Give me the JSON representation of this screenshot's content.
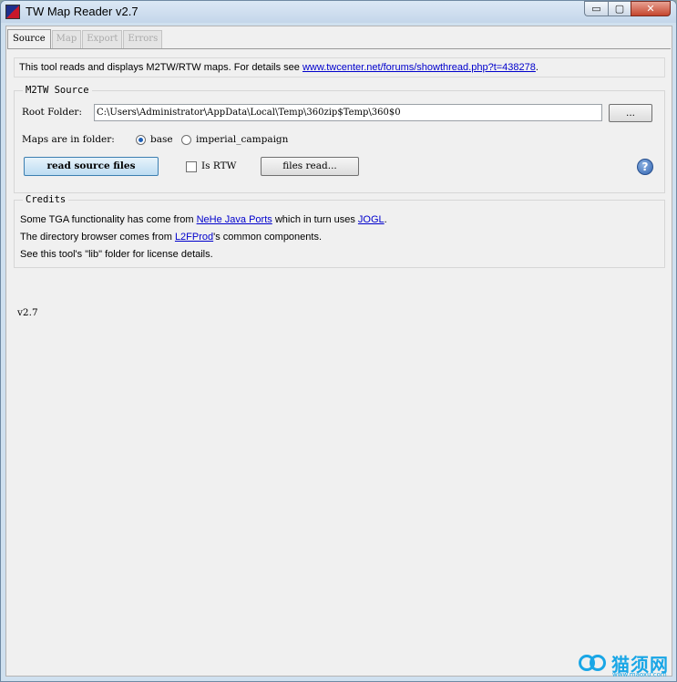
{
  "window": {
    "title": "TW Map Reader v2.7",
    "minimize_glyph": "▭",
    "maximize_glyph": "▢",
    "close_glyph": "✕"
  },
  "tabs": [
    {
      "label": "Source",
      "active": true
    },
    {
      "label": "Map",
      "active": false
    },
    {
      "label": "Export",
      "active": false
    },
    {
      "label": "Errors",
      "active": false
    }
  ],
  "info": {
    "text": "This tool reads and displays M2TW/RTW maps. For details see ",
    "link": "www.twcenter.net/forums/showthread.php?t=438278",
    "suffix": "."
  },
  "source_group": {
    "title": "M2TW Source",
    "root_folder_label": "Root Folder:",
    "root_folder_value": "C:\\Users\\Administrator\\AppData\\Local\\Temp\\360zip$Temp\\360$0",
    "browse_button": "...",
    "maps_in_folder_label": "Maps are in folder:",
    "radio_base": "base",
    "radio_imperial": "imperial_campaign",
    "read_button": "read source files",
    "is_rtw_label": "Is RTW",
    "files_read_button": "files read...",
    "help_glyph": "?"
  },
  "credits": {
    "title": "Credits",
    "line1_pre": "Some TGA functionality has come from ",
    "line1_link1": "NeHe Java Ports",
    "line1_mid": " which in turn uses ",
    "line1_link2": "JOGL",
    "line1_post": ".",
    "line2_pre": "The directory browser comes from ",
    "line2_link": "L2FProd",
    "line2_post": "'s common components.",
    "line3": "See this tool's \"lib\" folder for license details."
  },
  "version": "v2.7",
  "watermark": {
    "name": "猫须网",
    "url": "www.maoxu.com"
  },
  "colors": {
    "link": "#0000cc",
    "accent": "#3c7fb1"
  }
}
